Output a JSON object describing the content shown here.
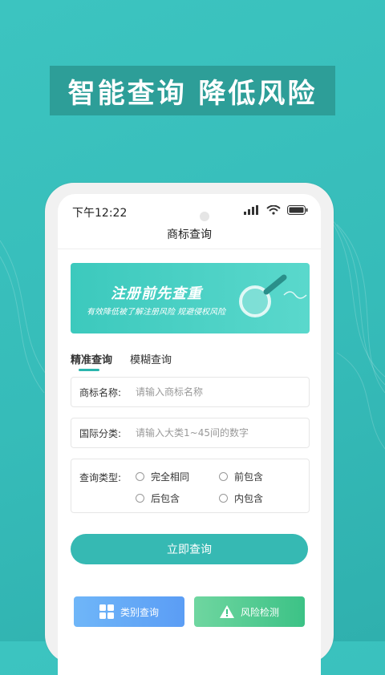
{
  "headline": "智能查询 降低风险",
  "status": {
    "time": "下午12:22"
  },
  "nav": {
    "title": "商标查询"
  },
  "banner": {
    "title": "注册前先查重",
    "subtitle": "有效降低被了解注册风险  规避侵权风险"
  },
  "tabs": [
    {
      "label": "精准查询",
      "active": true
    },
    {
      "label": "模糊查询",
      "active": false
    }
  ],
  "form": {
    "name_label": "商标名称:",
    "name_placeholder": "请输入商标名称",
    "class_label": "国际分类:",
    "class_placeholder": "请输入大类1~45间的数字",
    "type_label": "查询类型:",
    "options": [
      "完全相同",
      "前包含",
      "后包含",
      "内包含"
    ]
  },
  "buttons": {
    "query": "立即查询",
    "category": "类别查询",
    "risk": "风险检测"
  },
  "icons": [
    "signal-icon",
    "wifi-icon",
    "battery-icon",
    "grid-icon",
    "warning-icon",
    "magnifier-icon"
  ],
  "colors": {
    "accent": "#36b9b3",
    "blue": "#5b9df5",
    "green": "#3cc286"
  }
}
